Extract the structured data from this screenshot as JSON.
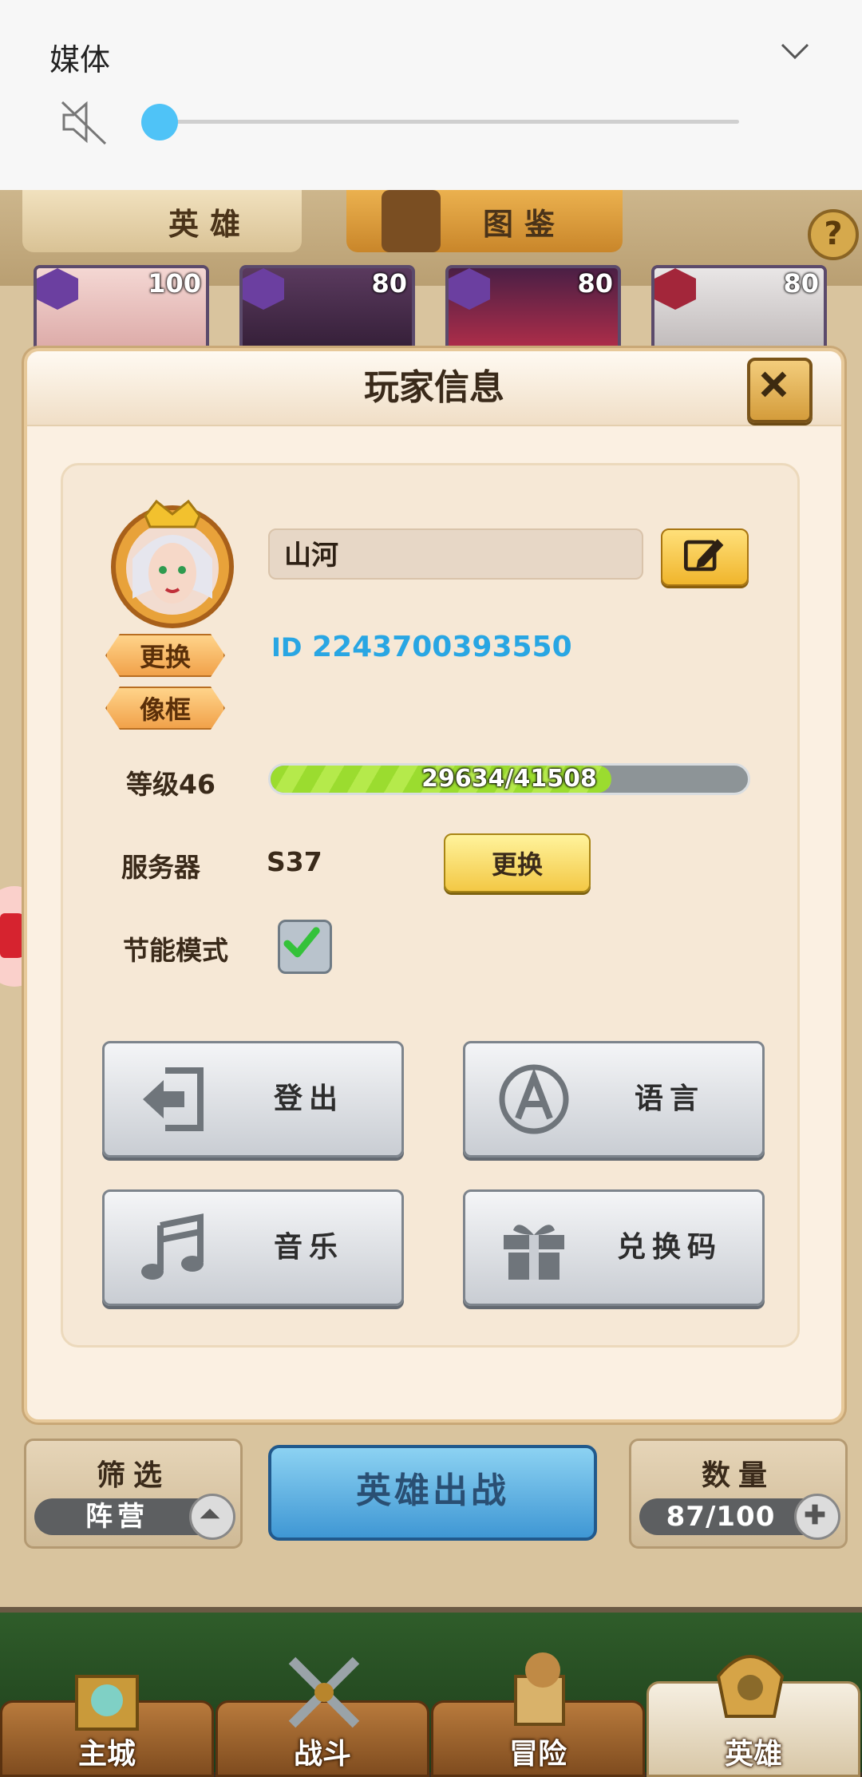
{
  "media": {
    "title": "媒体",
    "volume_level": 0.0
  },
  "top_tabs": {
    "hero": "英雄",
    "book": "图鉴"
  },
  "hero_cards": [
    {
      "level": "100"
    },
    {
      "level": "80"
    },
    {
      "level": "80"
    },
    {
      "level": "80"
    }
  ],
  "dialog": {
    "title": "玩家信息",
    "name": "山河",
    "change_avatar": "更换",
    "frame": "像框",
    "id_label": "ID",
    "id_value": "2243700393550",
    "level_label": "等级46",
    "xp_text": "29634/41508",
    "xp_fraction": 0.714,
    "server_label": "服务器",
    "server_value": "S37",
    "server_change": "更换",
    "energy_label": "节能模式",
    "energy_checked": true,
    "buttons": {
      "logout": "登出",
      "language": "语言",
      "music": "音乐",
      "redeem": "兑换码"
    }
  },
  "bottom": {
    "filter_title": "筛选",
    "filter_value": "阵营",
    "deploy": "英雄出战",
    "count_title": "数量",
    "count_value": "87/100"
  },
  "nav": {
    "city": "主城",
    "battle": "战斗",
    "adventure": "冒险",
    "hero": "英雄"
  }
}
